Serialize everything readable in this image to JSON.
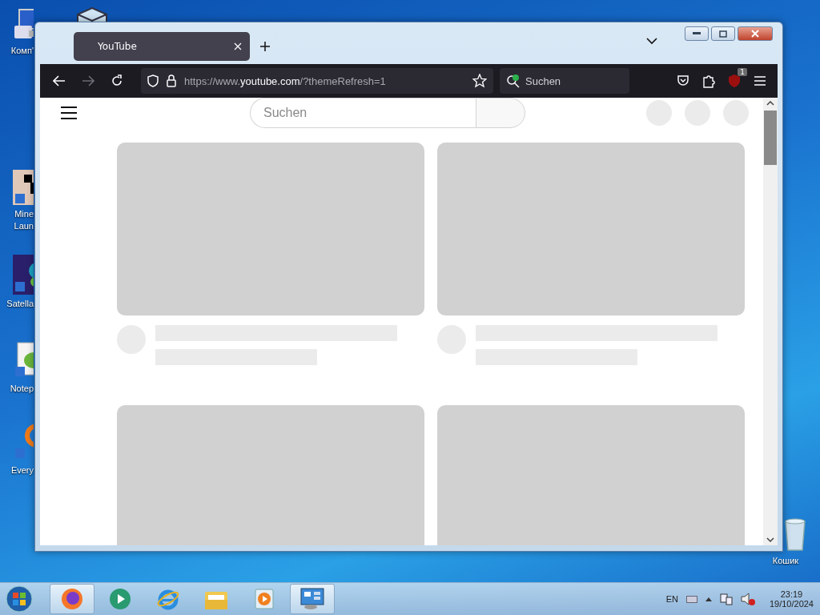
{
  "desktop_icons": [
    {
      "kind": "computer",
      "label": "Комп'"
    },
    {
      "kind": "box"
    },
    {
      "kind": "blocks",
      "label": "Mine\nLaun"
    },
    {
      "kind": "satellite",
      "label": "Satella"
    },
    {
      "kind": "notepad",
      "label": "Notep"
    },
    {
      "kind": "ring",
      "label": "Every"
    },
    {
      "kind": "bin",
      "label": "Кошик"
    }
  ],
  "browser": {
    "tabs": [
      {
        "title": "YouTube",
        "selected": true
      }
    ],
    "nav": {
      "forward_disabled": true
    },
    "url": {
      "prefix": "https://www.",
      "host": "youtube.com",
      "rest": "/?themeRefresh=1"
    },
    "search_placeholder": "Suchen",
    "extension_badge": "1"
  },
  "page": {
    "search": {
      "placeholder": "Suchen"
    }
  },
  "taskbar": {
    "apps": [
      {
        "kind": "firefox",
        "active": true
      },
      {
        "kind": "green",
        "active": false
      },
      {
        "kind": "ie",
        "active": false
      },
      {
        "kind": "folder",
        "active": false
      },
      {
        "kind": "player",
        "active": false
      },
      {
        "kind": "panel",
        "active": true
      }
    ],
    "tray": {
      "language": "EN",
      "time": "23:19",
      "date": "19/10/2024"
    }
  }
}
